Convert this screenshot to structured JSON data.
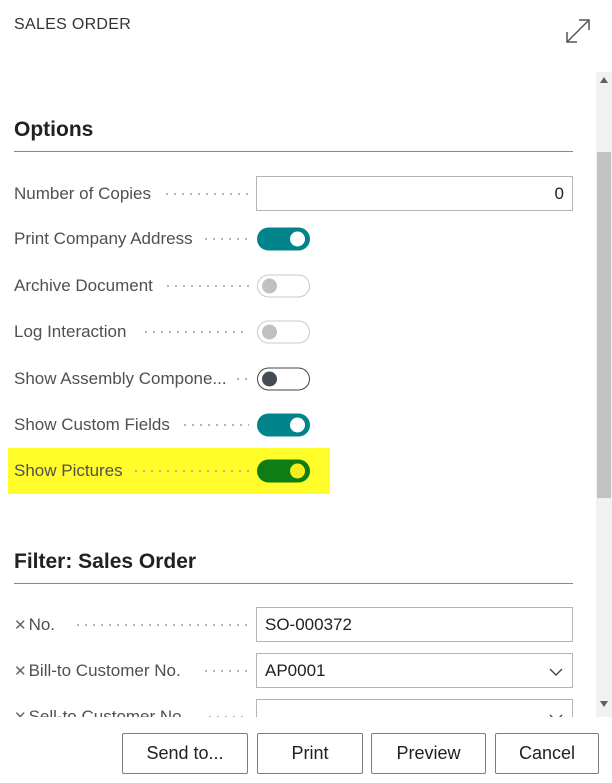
{
  "window": {
    "title": "SALES ORDER",
    "expand_icon": "expand-arrows-icon"
  },
  "options": {
    "heading": "Options",
    "number_of_copies": {
      "label": "Number of Copies",
      "value": "0"
    },
    "toggles": [
      {
        "label": "Print Company Address",
        "state": "on",
        "enabled": true
      },
      {
        "label": "Archive Document",
        "state": "off",
        "enabled": false
      },
      {
        "label": "Log Interaction",
        "state": "off",
        "enabled": false
      },
      {
        "label": "Show Assembly Compone...",
        "state": "off",
        "enabled": true
      },
      {
        "label": "Show Custom Fields",
        "state": "on",
        "enabled": true
      },
      {
        "label": "Show Pictures",
        "state": "on",
        "enabled": true,
        "highlighted": true
      }
    ]
  },
  "filter": {
    "heading": "Filter: Sales Order",
    "fields": [
      {
        "label": "No.",
        "value": "SO-000372",
        "type": "text"
      },
      {
        "label": "Bill-to Customer No.",
        "value": "AP0001",
        "type": "dropdown"
      },
      {
        "label": "Sell-to Customer No.",
        "value": "",
        "type": "dropdown"
      }
    ]
  },
  "buttons": {
    "send_to": "Send to...",
    "print": "Print",
    "preview": "Preview",
    "cancel": "Cancel"
  },
  "colors": {
    "toggle_on": "#00838a",
    "highlight": "#fffc2a",
    "highlight_toggle": "#0d7d14"
  }
}
